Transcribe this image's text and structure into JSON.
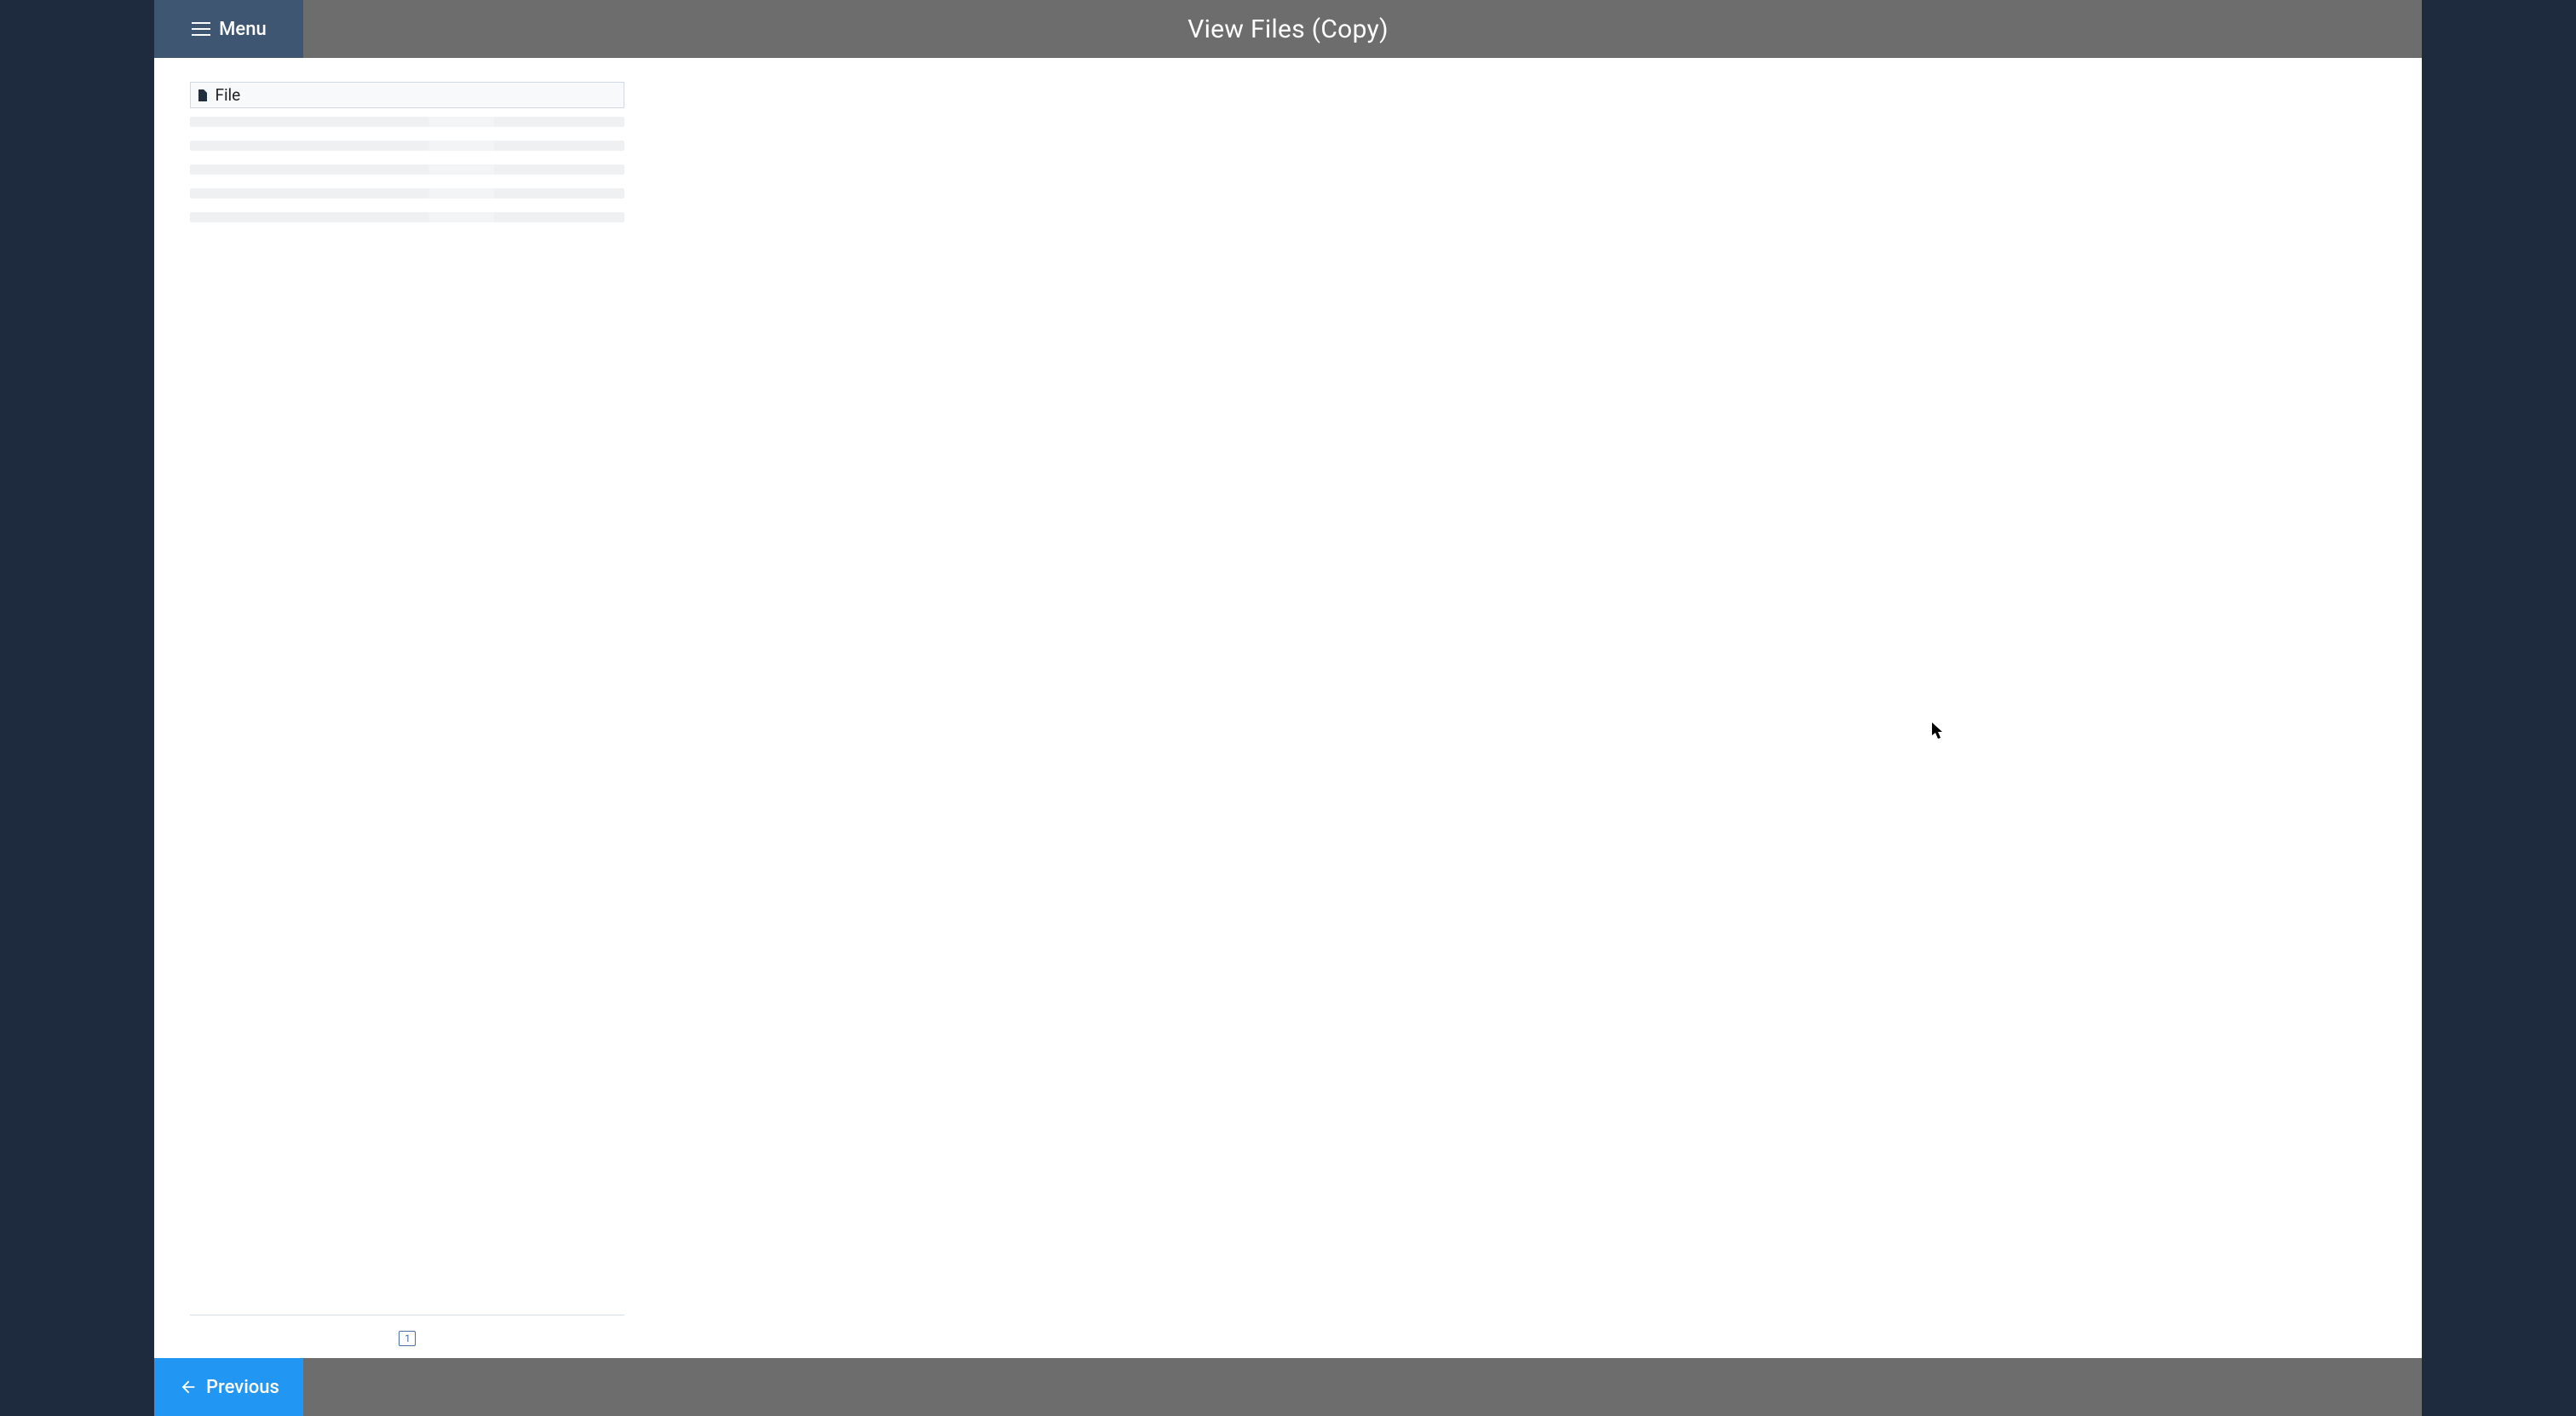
{
  "header": {
    "menu_label": "Menu",
    "title": "View Files (Copy)"
  },
  "file_panel": {
    "column_label": "File",
    "skeleton_rows": 5,
    "current_page": "1"
  },
  "footer": {
    "previous_label": "Previous"
  }
}
